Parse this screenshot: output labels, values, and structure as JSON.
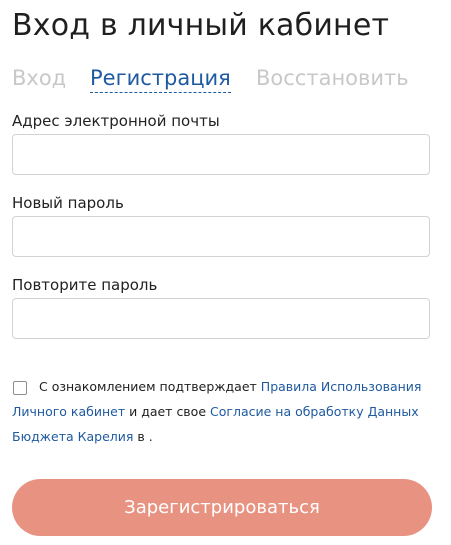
{
  "page": {
    "title": "Вход в личный кабинет"
  },
  "tabs": [
    {
      "label": "Вход"
    },
    {
      "label": "Регистрация"
    },
    {
      "label": "Восстановить"
    }
  ],
  "form": {
    "email_label": "Адрес электронной почты",
    "email_value": "",
    "password_label": "Новый пароль",
    "password_value": "",
    "password_repeat_label": "Повторите пароль",
    "password_repeat_value": "",
    "show_password_icon": "eye-icon"
  },
  "consent": {
    "checked": false,
    "text_1": "С ознакомлением подтверждает",
    "link_terms": "Правила Использования Личного кабинет",
    "text_2": "и дает свое",
    "link_consent": "Согласие на обработку Данных Бюджета Карелия",
    "text_3": "в ."
  },
  "submit": {
    "label": "Зарегистрироваться"
  },
  "colors": {
    "accent_link": "#1f5aa0",
    "button_bg": "#e89282",
    "inactive_tab": "#c8c8c8",
    "input_border": "#d3d3d3"
  }
}
